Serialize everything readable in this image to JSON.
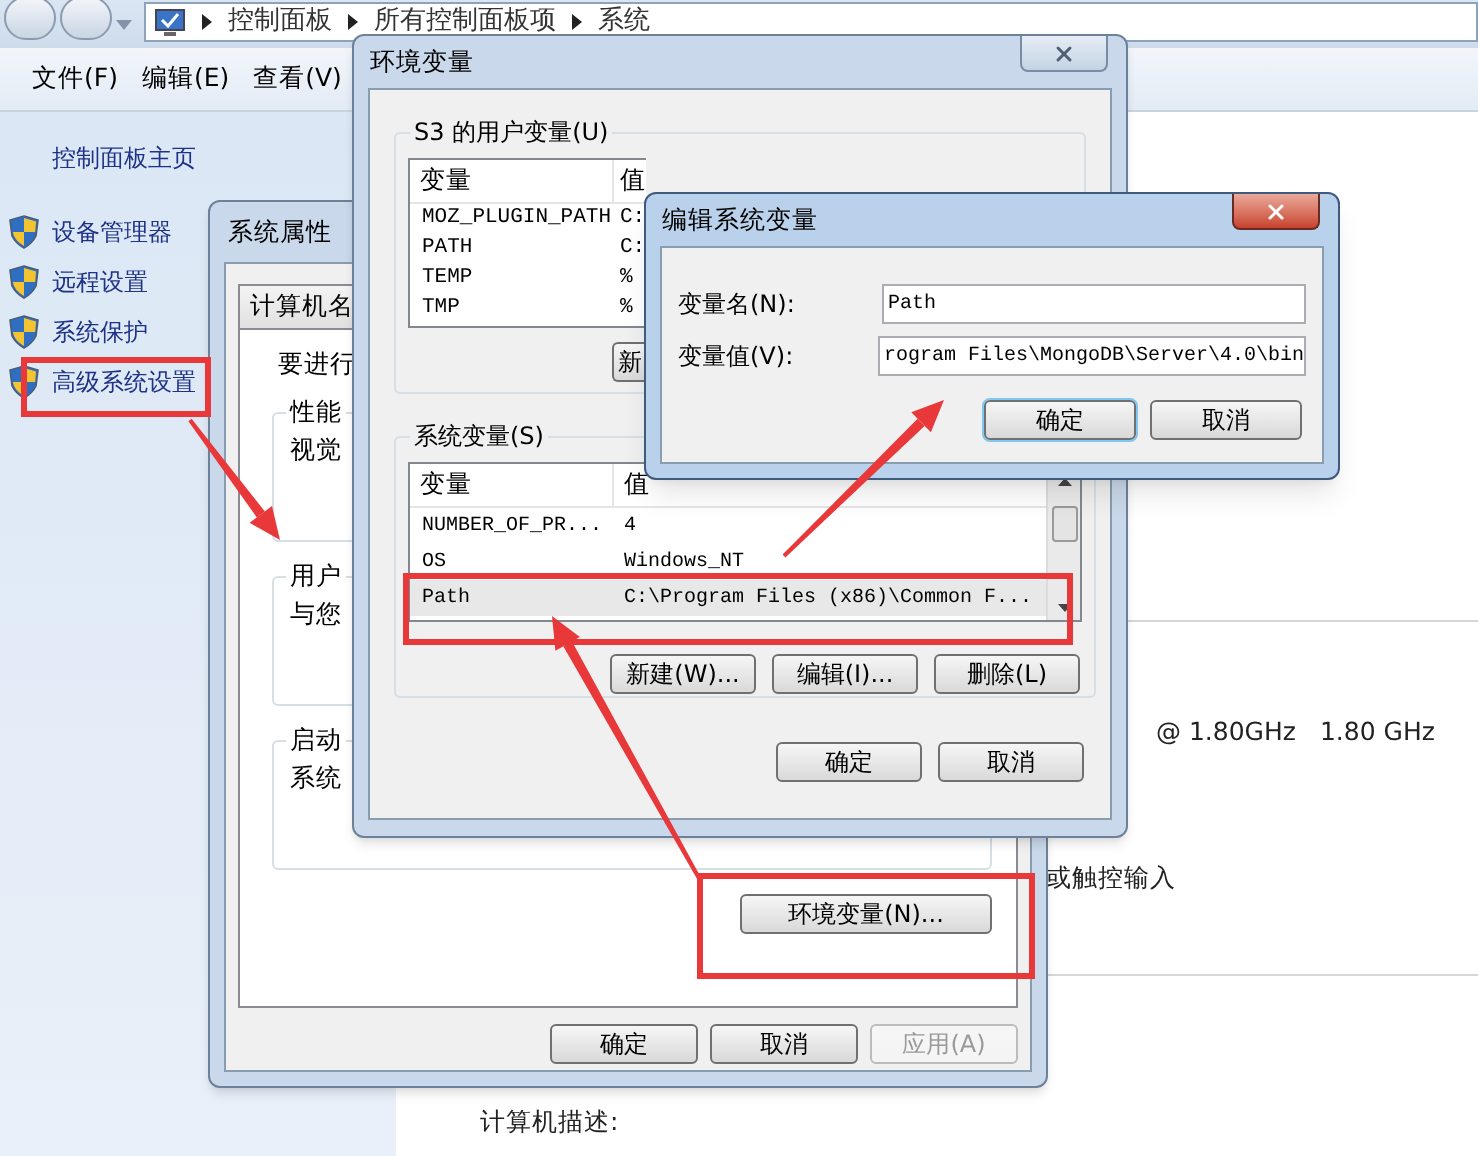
{
  "explorer": {
    "breadcrumb": [
      "控制面板",
      "所有控制面板项",
      "系统"
    ],
    "menu": [
      "文件(F)",
      "编辑(E)",
      "查看(V)"
    ],
    "sidebar": {
      "home": "控制面板主页",
      "items": [
        "设备管理器",
        "远程设置",
        "系统保护",
        "高级系统设置"
      ]
    },
    "processor": "@ 1.80GHz",
    "processor_speed": "1.80 GHz",
    "pen_touch": "或触控输入",
    "description_label": "计算机描述:"
  },
  "system_properties": {
    "title": "系统属性",
    "tabs": [
      {
        "label": "计算机名",
        "selected": false
      }
    ],
    "intro": "要进行",
    "groups": [
      {
        "title": "性能",
        "text": "视觉"
      },
      {
        "title": "用户",
        "text": "与您"
      },
      {
        "title": "启动",
        "text": "系统"
      }
    ],
    "env_button": "环境变量(N)...",
    "buttons": [
      {
        "label": "确定",
        "disabled": false
      },
      {
        "label": "取消",
        "disabled": false
      },
      {
        "label": "应用(A)",
        "disabled": true
      }
    ]
  },
  "environment_variables": {
    "title": "环境变量",
    "user_group": "S3 的用户变量(U)",
    "user_columns": [
      "变量",
      "值"
    ],
    "user_rows": [
      {
        "name": "MOZ_PLUGIN_PATH",
        "value": "C:"
      },
      {
        "name": "PATH",
        "value": "C:"
      },
      {
        "name": "TEMP",
        "value": "%"
      },
      {
        "name": "TMP",
        "value": "%"
      }
    ],
    "user_button": "新",
    "system_group": "系统变量(S)",
    "system_columns": [
      "变量",
      "值"
    ],
    "system_rows": [
      {
        "name": "NUMBER_OF_PR...",
        "value": "4",
        "selected": false
      },
      {
        "name": "OS",
        "value": "Windows_NT",
        "selected": false
      },
      {
        "name": "Path",
        "value": "C:\\Program Files (x86)\\Common F...",
        "selected": true
      }
    ],
    "system_buttons": [
      "新建(W)...",
      "编辑(I)...",
      "删除(L)"
    ],
    "buttons": [
      "确定",
      "取消"
    ]
  },
  "edit_variable": {
    "title": "编辑系统变量",
    "fields": [
      {
        "label": "变量名(N):",
        "value": "Path"
      },
      {
        "label": "变量值(V):",
        "value": "rogram Files\\MongoDB\\Server\\4.0\\bin"
      }
    ],
    "buttons": [
      {
        "label": "确定",
        "default": true
      },
      {
        "label": "取消",
        "default": false
      }
    ]
  }
}
